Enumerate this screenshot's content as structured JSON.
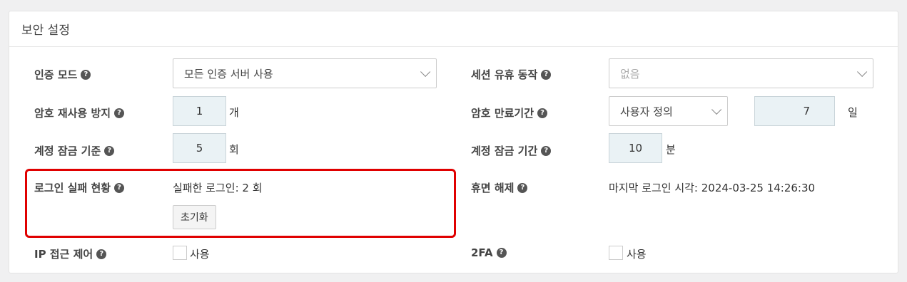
{
  "panel": {
    "title": "보안 설정"
  },
  "rows": {
    "auth_mode": {
      "label": "인증 모드",
      "value": "모든 인증 서버 사용"
    },
    "session_idle": {
      "label": "세션 유휴 동작",
      "value": "없음"
    },
    "pw_reuse": {
      "label": "암호 재사용 방지",
      "value": "1",
      "unit": "개"
    },
    "pw_expiry": {
      "label": "암호 만료기간",
      "mode": "사용자 정의",
      "value": "7",
      "unit": "일"
    },
    "lock_threshold": {
      "label": "계정 잠금 기준",
      "value": "5",
      "unit": "회"
    },
    "lock_duration": {
      "label": "계정 잠금 기간",
      "value": "10",
      "unit": "분"
    },
    "login_fail": {
      "label": "로그인 실패 현황",
      "text": "실패한 로그인: 2 회",
      "reset_button": "초기화"
    },
    "dormant_release": {
      "label": "휴면 해제",
      "text": "마지막 로그인 시각: 2024-03-25 14:26:30"
    },
    "ip_access": {
      "label": "IP 접근 제어",
      "checkbox_label": "사용"
    },
    "two_fa": {
      "label": "2FA",
      "checkbox_label": "사용"
    }
  },
  "icons": {
    "help": "question-circle-icon",
    "chevron": "chevron-down-icon"
  },
  "colors": {
    "highlight": "#e00000",
    "input_bg": "#eaf2f5"
  }
}
